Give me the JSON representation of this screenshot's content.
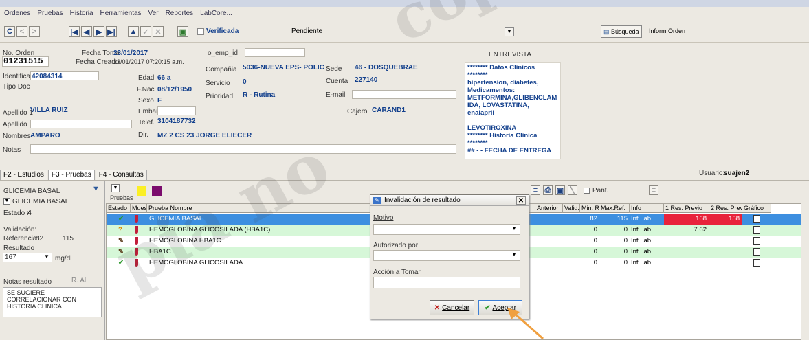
{
  "menu": [
    "Ordenes",
    "Pruebas",
    "Historia",
    "Herramientas",
    "Ver",
    "Reportes",
    "LabCore..."
  ],
  "toolbar": {
    "verificada": "Verificada",
    "pendiente": "Pendiente",
    "busqueda": "Búsqueda",
    "inform_orden": "Inform Orden"
  },
  "order": {
    "no_orden_label": "No. Orden",
    "no_orden": "01231515",
    "fecha_toma_label": "Fecha Toma",
    "fecha_toma": "23/01/2017",
    "fecha_creado_label": "Fecha Creado",
    "fecha_creado": "23/01/2017 07:20:15 a.m.",
    "o_emp_id_label": "o_emp_id",
    "identificacion_label": "Identificacion",
    "identificacion": "42084314",
    "edad_label": "Edad",
    "edad": "66 a",
    "compania_label": "Compañia",
    "compania": "5036-NUEVA EPS- POLIC",
    "sede_label": "Sede",
    "sede": "46 - DOSQUEBRAE",
    "tipo_doc_label": "Tipo Doc",
    "fnac_label": "F.Nac",
    "fnac": "08/12/1950",
    "servicio_label": "Servicio",
    "servicio": "0",
    "cuenta_label": "Cuenta",
    "cuenta": "227140",
    "sexo_label": "Sexo",
    "sexo": "F",
    "prioridad_label": "Prioridad",
    "prioridad": "R - Rutina",
    "email_label": "E-mail",
    "cajero_label": "Cajero",
    "cajero": "CARAND1",
    "apellido1_label": "Apellido 1",
    "apellido1": "VILLA RUIZ",
    "embar_label": "Embar.",
    "apellido2_label": "Apellido 2",
    "telef_label": "Telef.",
    "telef": "3104187732",
    "nombres_label": "Nombres",
    "nombres": "AMPARO",
    "dir_label": "Dir.",
    "dir": "MZ 2 CS 23 JORGE ELIECER",
    "notas_label": "Notas",
    "entrevista": "ENTREVISTA",
    "clinical_text": "******** Datos Clinicos\n********\nhipertension, diabetes,\nMedicamentos:\nMETFORMINA,GLIBENCLAM\nIDA, LOVASTATINA,\nenalapril\n\nLEVOTIROXINA\n******** Historia Clinica\n********\n## - - FECHA DE ENTREGA"
  },
  "tabs": [
    "F2 - Estudios",
    "F3 - Pruebas",
    "F4 - Consultas"
  ],
  "usuario_label": "Usuario:",
  "usuario": "suajen2",
  "left_panel": {
    "test_name": "GLICEMIA BASAL",
    "test_select": "GLICEMIA BASAL",
    "estado_label": "Estado :",
    "estado": "4",
    "validacion_label": "Validación:",
    "referencia_label": "Referencia:",
    "ref_min": "82",
    "ref_max": "115",
    "resultado_label": "Resultado",
    "resultado": "167",
    "unit": "mg/dl",
    "notas_label": "Notas resultado",
    "notas_flag": "R. Al",
    "nota": "SE SUGIERE\nCORRELACIONAR CON\nHISTORIA CLINICA."
  },
  "grid": {
    "pruebas_label": "Pruebas",
    "pant_label": "Pant.",
    "columns": [
      "Estado",
      "Mues..",
      "Prueba Nombre",
      "Anterior",
      "Valid..",
      "Min. R..",
      "Max.Ref.",
      "Info",
      "1 Res. Previo",
      "2 Res. Previo",
      "Gráfico"
    ],
    "rows": [
      {
        "status": "✔",
        "name": "GLICEMIA BASAL",
        "min": "82",
        "max": "115",
        "info": "Inf Lab",
        "prev1": "168",
        "prev2": "158"
      },
      {
        "status": "?",
        "name": "HEMOGLOBINA GLICOSILADA (HBA1C)",
        "min": "0",
        "max": "0",
        "info": "Inf Lab",
        "prev1": "7.62",
        "prev2": ""
      },
      {
        "status": "✎",
        "name": "HEMOGLOBINA HBA1C",
        "min": "0",
        "max": "0",
        "info": "Inf Lab",
        "prev1": "...",
        "prev2": ""
      },
      {
        "status": "✎",
        "name": "HBA1C",
        "min": "0",
        "max": "0",
        "info": "Inf Lab",
        "prev1": "...",
        "prev2": ""
      },
      {
        "status": "✔",
        "name": "HEMOGLOBINA GLICOSILADA",
        "min": "0",
        "max": "0",
        "info": "Inf Lab",
        "prev1": "...",
        "prev2": ""
      }
    ]
  },
  "dialog": {
    "title": "Invalidación de resultado",
    "motivo_label": "Motivo",
    "autorizado_label": "Autorizado por",
    "accion_label": "Acción a Tomar",
    "cancel": "Cancelar",
    "accept": "Aceptar"
  },
  "watermark": {
    "line1": "copia no con",
    "line2": "pia no"
  },
  "colors": {
    "selected_row": "#3d8fe0",
    "green_row": "#d6f7d8",
    "value_blue": "#123f8c",
    "prev_red": "#e8233b",
    "arrow": "#f0a040"
  }
}
